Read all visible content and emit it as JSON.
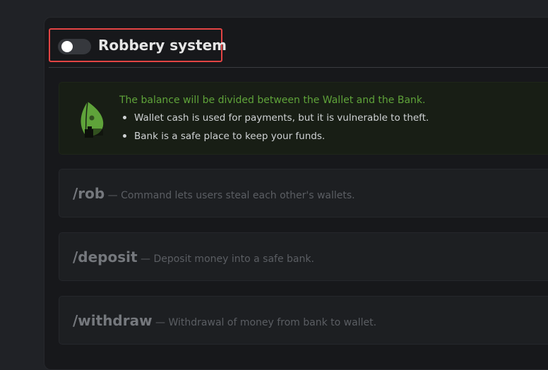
{
  "robbery": {
    "title": "Robbery system",
    "enabled": false
  },
  "info": {
    "icon": "leaf-wallet-icon",
    "accent_color": "#5fa33a",
    "headline": "The balance will be divided between the Wallet and the Bank.",
    "bullets": [
      "Wallet cash is used for payments, but it is vulnerable to theft.",
      "Bank is a safe place to keep your funds."
    ]
  },
  "commands": [
    {
      "name": "/rob",
      "description": " — Command lets users steal each other's wallets."
    },
    {
      "name": "/deposit",
      "description": " — Deposit money into a safe bank."
    },
    {
      "name": "/withdraw",
      "description": " — Withdrawal of money from bank to wallet."
    }
  ]
}
